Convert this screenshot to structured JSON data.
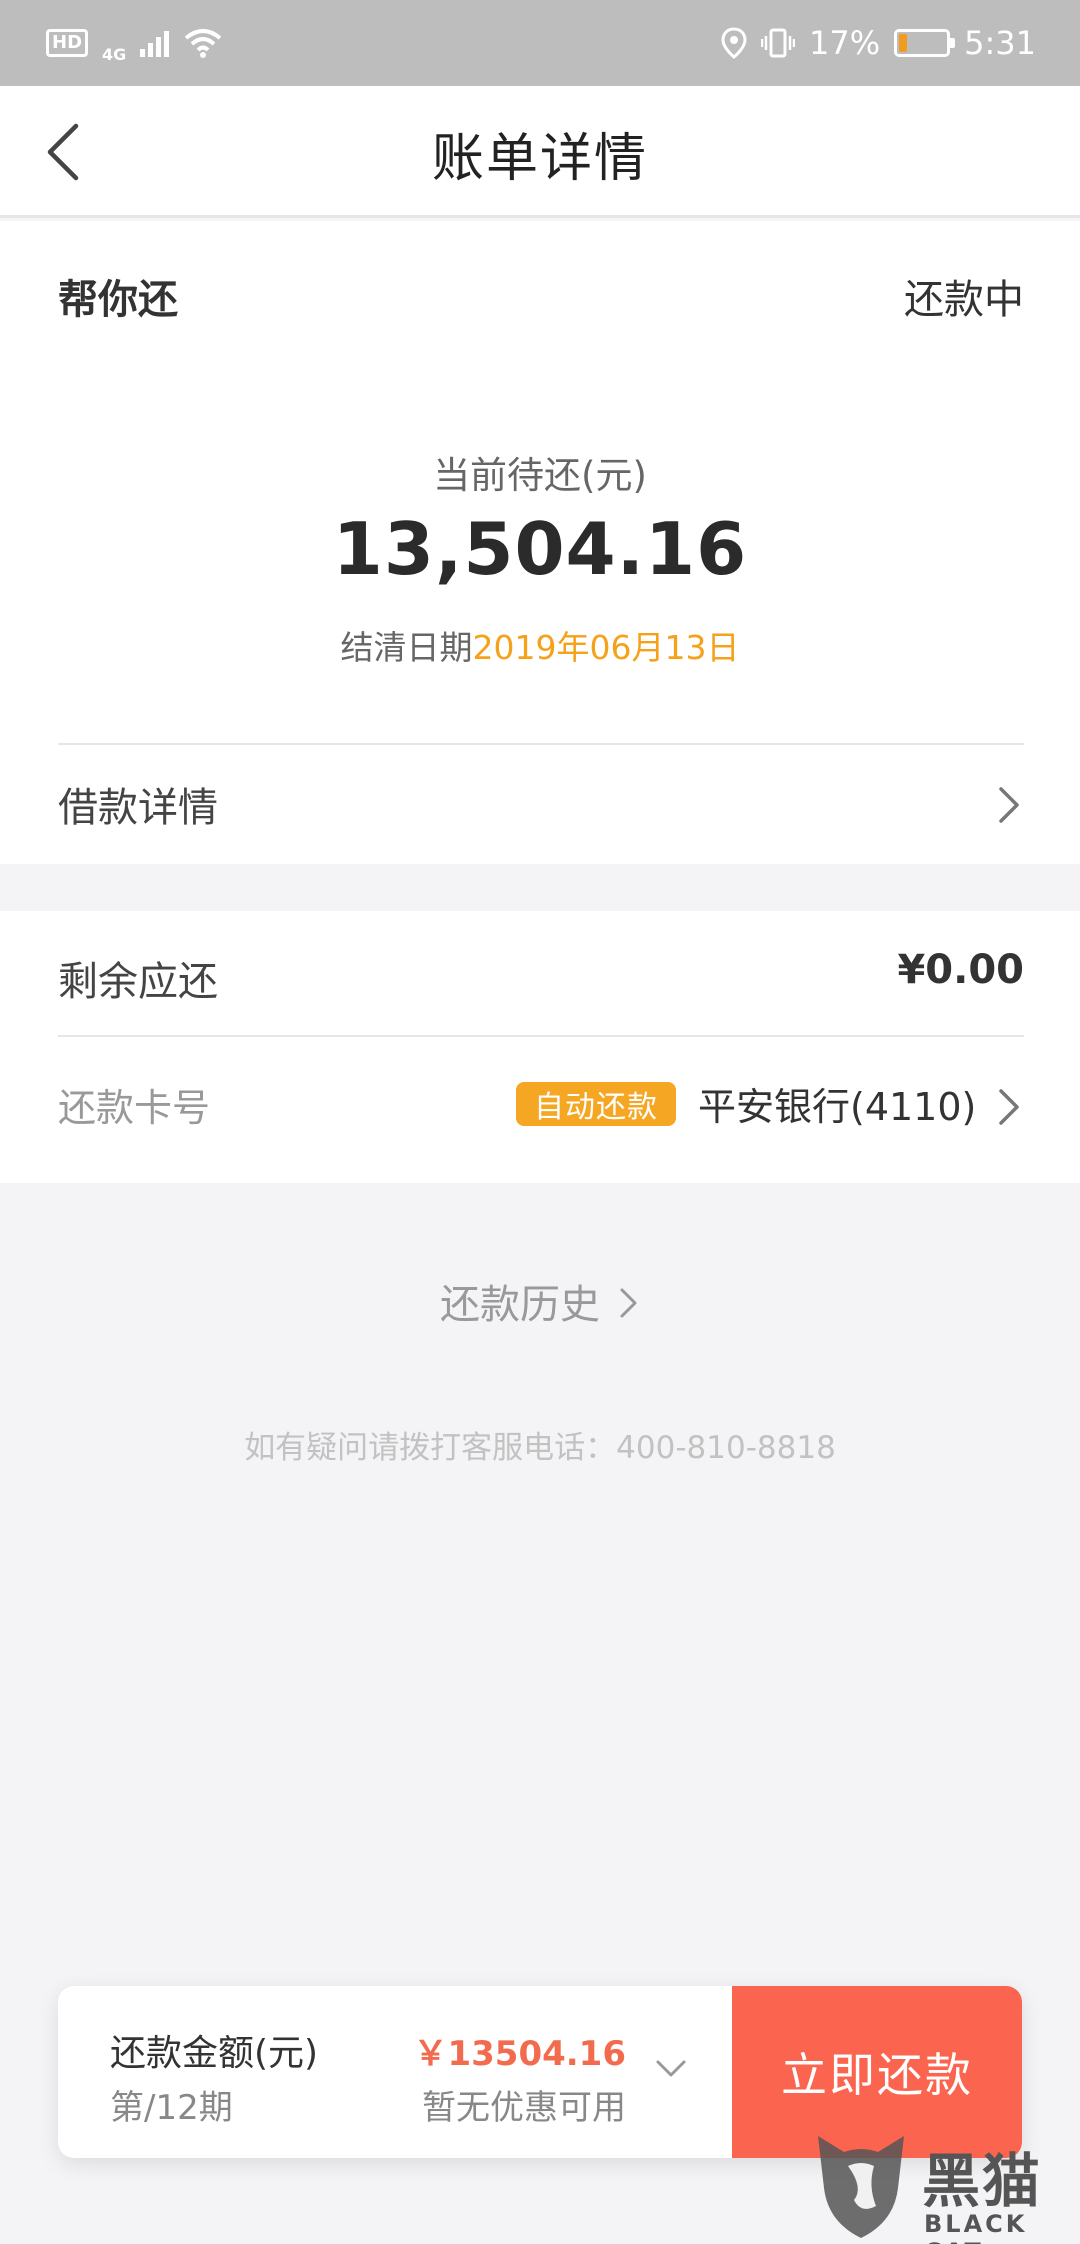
{
  "status_bar": {
    "hd": "HD",
    "network": "4G",
    "battery_percent": "17%",
    "battery_level": 0.17,
    "time": "5:31",
    "battery_color": "#f29b1f"
  },
  "nav": {
    "title": "账单详情",
    "back_icon": "chevron-left-icon"
  },
  "summary": {
    "product": "帮你还",
    "status": "还款中",
    "due_label": "当前待还(元)",
    "due_amount": "13,504.16",
    "settle_prefix": "结清日期",
    "settle_date": "2019年06月13日",
    "loan_details_label": "借款详情"
  },
  "repayment": {
    "remaining_label": "剩余应还",
    "remaining_value": "¥0.00",
    "card_label": "还款卡号",
    "auto_badge": "自动还款",
    "bank": "平安银行(4110)"
  },
  "history_label": "还款历史",
  "hotline": "如有疑问请拨打客服电话：400-810-8818",
  "pay_bar": {
    "amount_label": "还款金额(元)",
    "period": "第/12期",
    "amount": "￥13504.16",
    "promo": "暂无优惠可用",
    "button": "立即还款"
  },
  "watermark": {
    "text": "黑猫",
    "sub": "BLACK CAT"
  },
  "colors": {
    "accent_orange": "#f5a21a",
    "badge_orange": "#f5a623",
    "pay_red": "#fb654f",
    "amount_red": "#f26b4f"
  }
}
